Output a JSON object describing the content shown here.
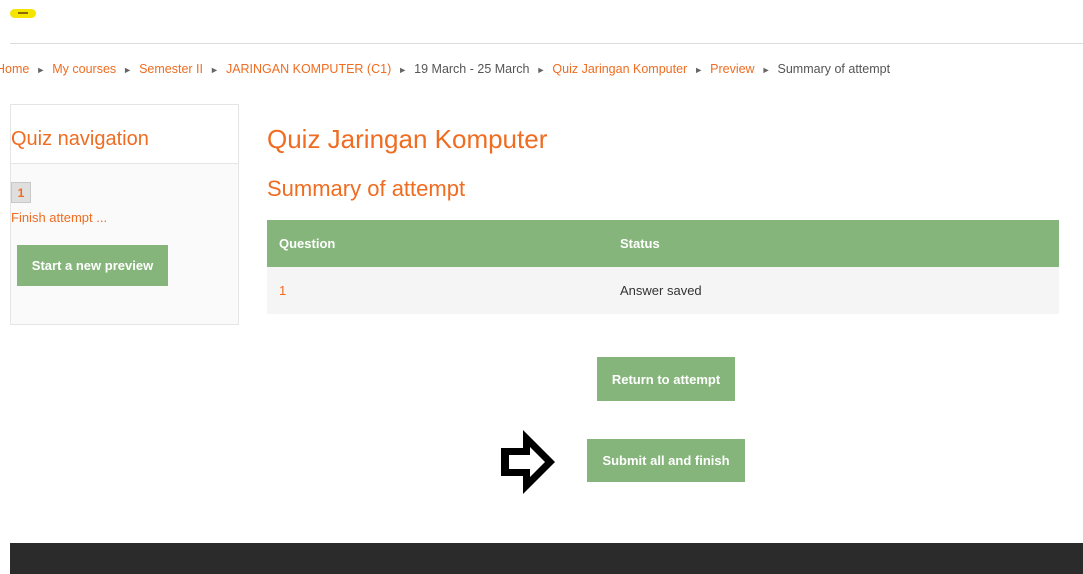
{
  "breadcrumb": {
    "items": [
      {
        "label": "Home"
      },
      {
        "label": "My courses"
      },
      {
        "label": "Semester II"
      },
      {
        "label": "JARINGAN KOMPUTER (C1)"
      },
      {
        "label": "19 March - 25 March"
      },
      {
        "label": "Quiz Jaringan Komputer"
      },
      {
        "label": "Preview"
      },
      {
        "label": "Summary of attempt"
      }
    ],
    "separator": "►"
  },
  "quiz_navigation": {
    "title": "Quiz navigation",
    "question_buttons": [
      "1"
    ],
    "finish_attempt_label": "Finish attempt ...",
    "new_preview_button": "Start a new preview"
  },
  "main": {
    "quiz_title": "Quiz Jaringan Komputer",
    "section_title": "Summary of attempt",
    "table": {
      "headers": [
        "Question",
        "Status"
      ],
      "rows": [
        {
          "question": "1",
          "status": "Answer saved"
        }
      ]
    },
    "return_button": "Return to attempt",
    "submit_button": "Submit all and finish"
  },
  "annotations": {
    "arrow_icon": "right-arrow-icon"
  },
  "colors": {
    "accent": "#ef6c21",
    "button": "#85b57a",
    "footer": "#2b2b2b"
  }
}
